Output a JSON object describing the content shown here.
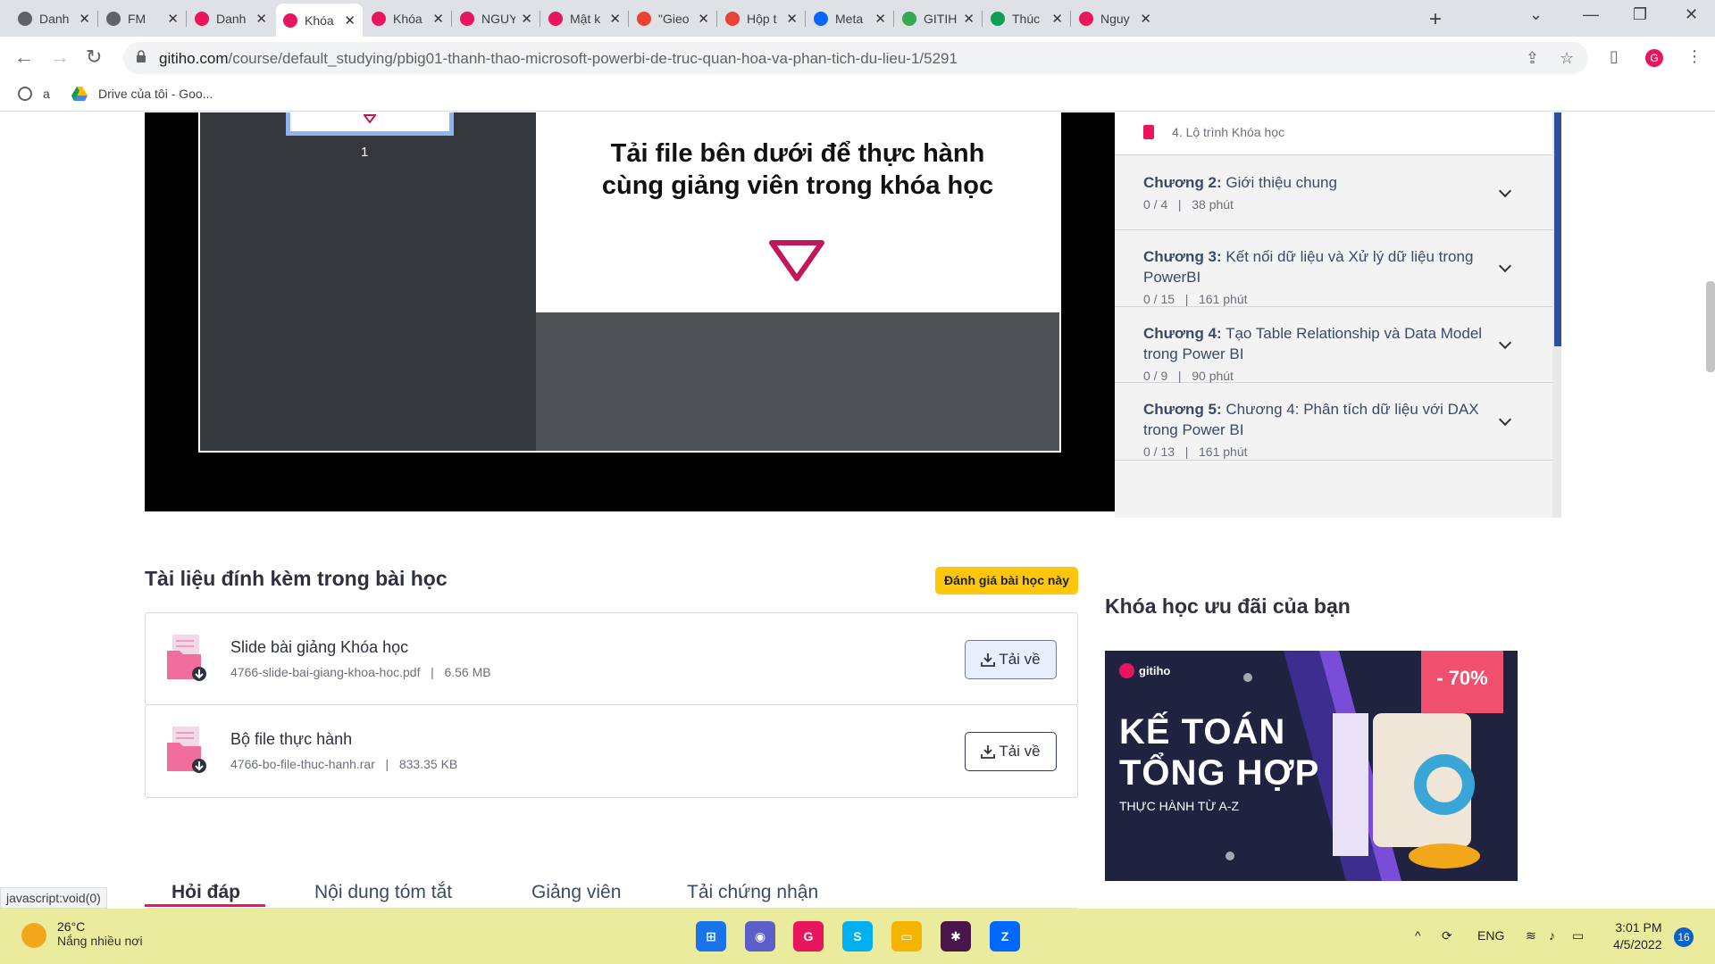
{
  "browser": {
    "tabs": [
      {
        "title": "Danh",
        "favicon": "globe-icon",
        "color": "#5f6368"
      },
      {
        "title": "FM",
        "favicon": "globe-icon",
        "color": "#5f6368"
      },
      {
        "title": "Danh",
        "favicon": "gitiho-icon",
        "color": "#e8175d"
      },
      {
        "title": "Khóa",
        "favicon": "gitiho-icon",
        "color": "#e8175d",
        "active": true
      },
      {
        "title": "Khóa",
        "favicon": "gitiho-icon",
        "color": "#e8175d"
      },
      {
        "title": "NGUY",
        "favicon": "gitiho-icon",
        "color": "#e8175d"
      },
      {
        "title": "Mật k",
        "favicon": "gitiho-icon",
        "color": "#e8175d"
      },
      {
        "title": "\"Gieo",
        "favicon": "gmail-icon",
        "color": "#ea4335"
      },
      {
        "title": "Hộp t",
        "favicon": "gmail-icon",
        "color": "#ea4335"
      },
      {
        "title": "Meta",
        "favicon": "meta-icon",
        "color": "#0866ff"
      },
      {
        "title": "GITIH",
        "favicon": "drive-icon",
        "color": "#34a853"
      },
      {
        "title": "Thúc",
        "favicon": "sheets-icon",
        "color": "#0f9d58"
      },
      {
        "title": "Nguy",
        "favicon": "gitiho-icon",
        "color": "#e8175d"
      }
    ],
    "url_domain": "gitiho.com",
    "url_path": "/course/default_studying/pbig01-thanh-thao-microsoft-powerbi-de-truc-quan-hoa-va-phan-tich-du-lieu-1/5291",
    "bookmarks": [
      {
        "label": "a",
        "icon": "globe-icon"
      },
      {
        "label": "Drive của tôi - Goo...",
        "icon": "drive-icon"
      }
    ]
  },
  "video": {
    "thumb_number": "1",
    "slide_line1": "Tải file bên dưới để thực hành",
    "slide_line2": "cùng giảng viên trong khóa học"
  },
  "chapters": {
    "roadmap": "4. Lộ trình Khóa học",
    "items": [
      {
        "prefix": "Chương 2:",
        "title": "Giới thiệu chung",
        "progress": "0 / 4",
        "duration": "38 phút"
      },
      {
        "prefix": "Chương 3:",
        "title": "Kết nối dữ liệu và Xử lý dữ liệu trong PowerBI",
        "progress": "0 / 15",
        "duration": "161 phút"
      },
      {
        "prefix": "Chương 4:",
        "title": "Tạo Table Relationship và Data Model trong Power BI",
        "progress": "0 / 9",
        "duration": "90 phút"
      },
      {
        "prefix": "Chương 5:",
        "title": "Chương 4: Phân tích dữ liệu với DAX trong Power BI",
        "progress": "0 / 13",
        "duration": "161 phút"
      }
    ],
    "separator": "|"
  },
  "attachments": {
    "title": "Tài liệu đính kèm trong bài học",
    "rate_button": "Đánh giá bài học này",
    "files": [
      {
        "name": "Slide bài giảng Khóa học",
        "filename": "4766-slide-bai-giang-khoa-hoc.pdf",
        "size": "6.56 MB",
        "button": "Tải về"
      },
      {
        "name": "Bộ file thực hành",
        "filename": "4766-bo-file-thuc-hanh.rar",
        "size": "833.35 KB",
        "button": "Tải về"
      }
    ]
  },
  "content_tabs": [
    "Hỏi đáp",
    "Nội dung tóm tắt",
    "Giảng viên",
    "Tải chứng nhận"
  ],
  "promo": {
    "title": "Khóa học ưu đãi của bạn",
    "brand": "gitiho",
    "line1": "KẾ TOÁN",
    "line2": "TỔNG HỢP",
    "subtitle": "THỰC HÀNH TỪ A-Z",
    "discount": "- 70%"
  },
  "status_url": "javascript:void(0)",
  "taskbar": {
    "temp": "26°C",
    "condition": "Nắng nhiều nơi",
    "language": "ENG",
    "time": "3:01 PM",
    "date": "4/5/2022",
    "notifications": "16",
    "apps": [
      {
        "name": "windows-start-icon",
        "color": "#1a73e8"
      },
      {
        "name": "teams-icon",
        "color": "#5b5fc7"
      },
      {
        "name": "chrome-icon",
        "color": "#e8175d"
      },
      {
        "name": "skype-icon",
        "color": "#00aff0"
      },
      {
        "name": "file-explorer-icon",
        "color": "#f4b400"
      },
      {
        "name": "slack-icon",
        "color": "#4a154b"
      },
      {
        "name": "zalo-icon",
        "color": "#0068ff"
      }
    ]
  }
}
